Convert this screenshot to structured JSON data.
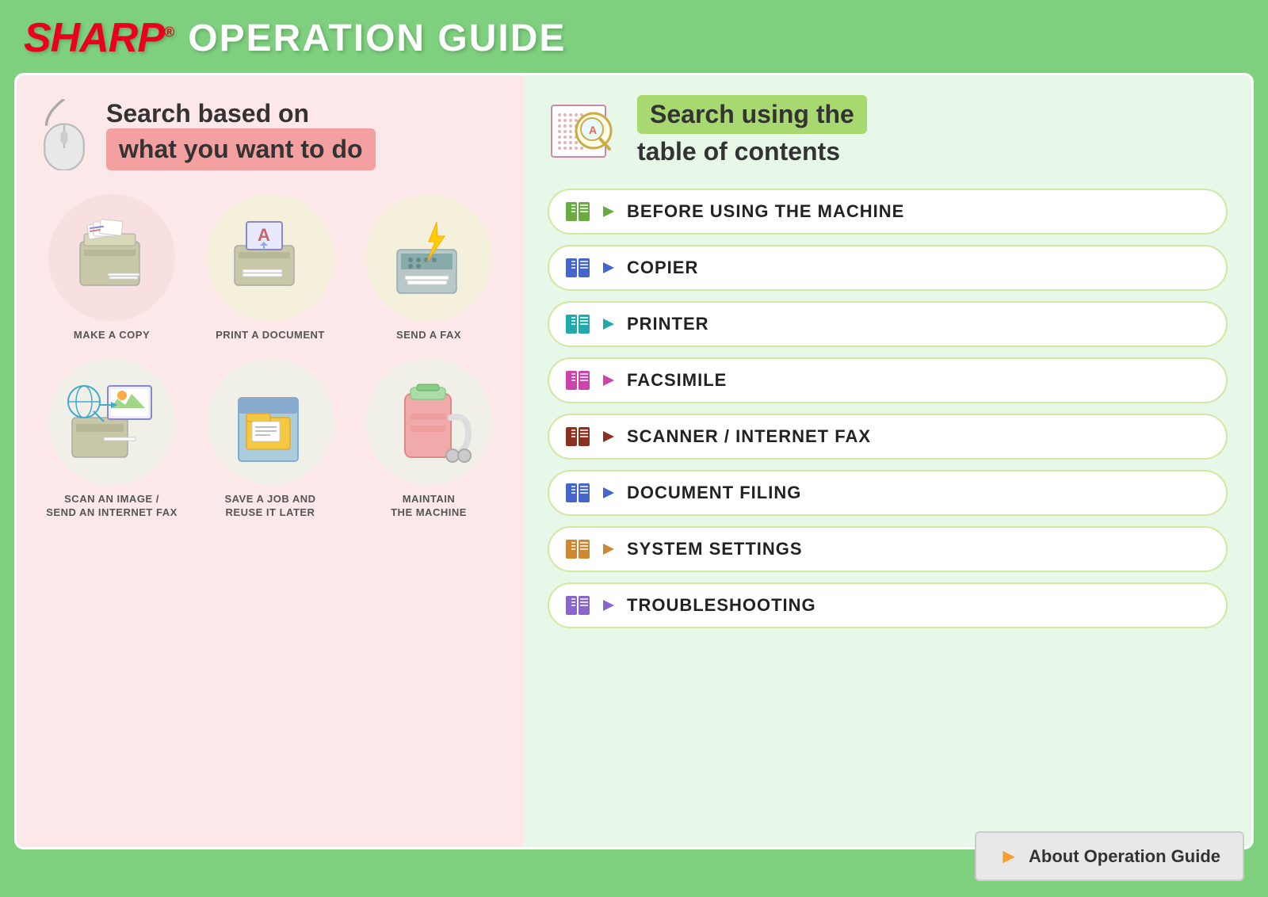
{
  "header": {
    "logo": "SHARP",
    "logo_r": "®",
    "title": "OPERATION GUIDE"
  },
  "left_section": {
    "title_line1": "Search based on",
    "title_line2": "what you want to do",
    "items": [
      {
        "id": "make-a-copy",
        "label": "MAKE A COPY",
        "circle_color": "pink"
      },
      {
        "id": "print-a-document",
        "label": "PRINT A DOCUMENT",
        "circle_color": "cream"
      },
      {
        "id": "send-a-fax",
        "label": "SEND A FAX",
        "circle_color": "cream"
      },
      {
        "id": "scan-an-image",
        "label": "SCAN AN IMAGE /\nSEND AN INTERNET FAX",
        "circle_color": "light"
      },
      {
        "id": "save-a-job",
        "label": "SAVE A JOB AND\nREUSE IT LATER",
        "circle_color": "light"
      },
      {
        "id": "maintain-the-machine",
        "label": "MAINTAIN\nTHE MACHINE",
        "circle_color": "light"
      }
    ]
  },
  "right_section": {
    "title_line1": "Search using the",
    "title_line2": "table of contents",
    "menu_items": [
      {
        "id": "before-using",
        "label": "BEFORE USING THE MACHINE",
        "book_color": "#6aaa40",
        "icon_color": "#6aaa40"
      },
      {
        "id": "copier",
        "label": "COPIER",
        "book_color": "#4466cc",
        "icon_color": "#4466cc"
      },
      {
        "id": "printer",
        "label": "PRINTER",
        "book_color": "#22aaaa",
        "icon_color": "#22aaaa"
      },
      {
        "id": "facsimile",
        "label": "FACSIMILE",
        "book_color": "#cc44aa",
        "icon_color": "#cc44aa"
      },
      {
        "id": "scanner-fax",
        "label": "SCANNER / INTERNET FAX",
        "book_color": "#883322",
        "icon_color": "#883322"
      },
      {
        "id": "document-filing",
        "label": "DOCUMENT FILING",
        "book_color": "#4466cc",
        "icon_color": "#4466cc"
      },
      {
        "id": "system-settings",
        "label": "SYSTEM SETTINGS",
        "book_color": "#cc8833",
        "icon_color": "#cc8833"
      },
      {
        "id": "troubleshooting",
        "label": "TROUBLESHOOTING",
        "book_color": "#8866cc",
        "icon_color": "#8866cc"
      }
    ]
  },
  "footer": {
    "about_label": "About Operation Guide"
  }
}
